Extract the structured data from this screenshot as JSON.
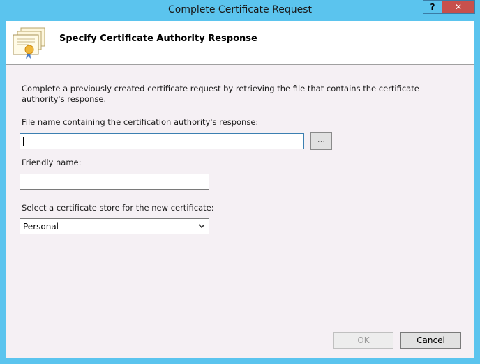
{
  "window": {
    "title": "Complete Certificate Request",
    "help_label": "?",
    "close_label": "✕"
  },
  "header": {
    "title": "Specify Certificate Authority Response",
    "icon": "certificate-icon"
  },
  "form": {
    "intro": "Complete a previously created certificate request by retrieving the file that contains the certificate authority's response.",
    "file_label": "File name containing the certification authority's response:",
    "file_value": "",
    "browse_label": "...",
    "friendly_label": "Friendly name:",
    "friendly_value": "",
    "store_label": "Select a certificate store for the new certificate:",
    "store_selected": "Personal"
  },
  "footer": {
    "ok_label": "OK",
    "cancel_label": "Cancel"
  }
}
